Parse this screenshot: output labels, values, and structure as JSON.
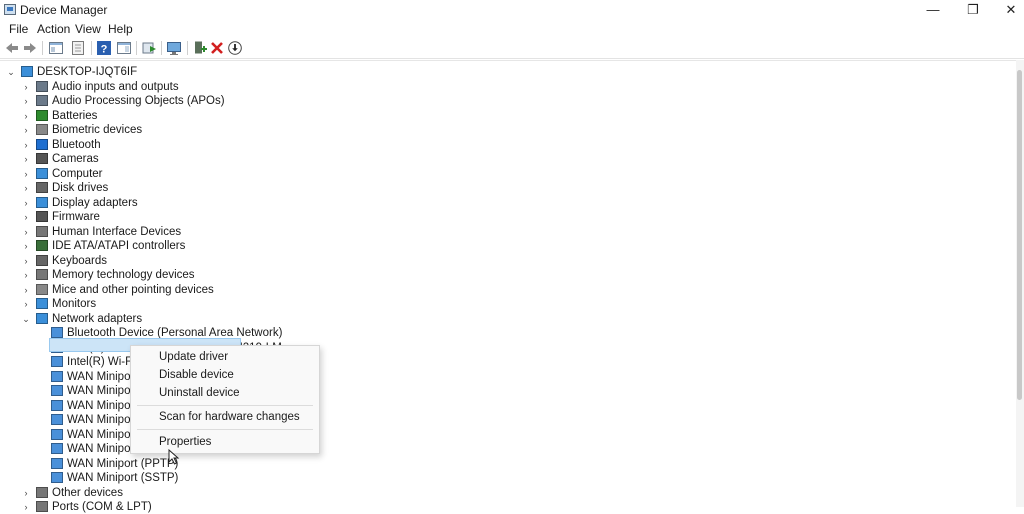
{
  "window": {
    "title": "Device Manager",
    "minimize": "—",
    "restore": "❐",
    "close": "✕"
  },
  "menu": [
    "File",
    "Action",
    "View",
    "Help"
  ],
  "toolbar": {
    "icons": [
      "back-arrow-icon",
      "forward-arrow-icon",
      "console-tree-icon",
      "properties-sheet-icon",
      "help-icon",
      "pane-icon",
      "update-driver-icon",
      "scan-hardware-icon",
      "add-legacy-icon",
      "uninstall-icon",
      "disable-icon"
    ]
  },
  "colors": {
    "selection": "#cce4f7",
    "accent": "#3b78c0",
    "uninstall_red": "#d21f1f",
    "add_green": "#2e8b2e"
  },
  "tree": {
    "root": "DESKTOP-IJQT6IF",
    "categories": [
      "Audio inputs and outputs",
      "Audio Processing Objects (APOs)",
      "Batteries",
      "Biometric devices",
      "Bluetooth",
      "Cameras",
      "Computer",
      "Disk drives",
      "Display adapters",
      "Firmware",
      "Human Interface Devices",
      "IDE ATA/ATAPI controllers",
      "Keyboards",
      "Memory technology devices",
      "Mice and other pointing devices",
      "Monitors",
      "Network adapters"
    ],
    "network_children": [
      "Bluetooth Device (Personal Area Network)",
      "Intel(R) Ethernet Connection (17) I219-LM",
      "Intel(R) Wi-Fi 6",
      "WAN Miniport",
      "WAN Miniport",
      "WAN Miniport",
      "WAN Miniport",
      "WAN Miniport",
      "WAN Miniport",
      "WAN Miniport (PPTP)",
      "WAN Miniport (SSTP)"
    ],
    "after": [
      "Other devices",
      "Ports (COM & LPT)"
    ]
  },
  "context_menu": {
    "update_driver": "Update driver",
    "disable_device": "Disable device",
    "uninstall_device": "Uninstall device",
    "scan": "Scan for hardware changes",
    "properties": "Properties"
  }
}
